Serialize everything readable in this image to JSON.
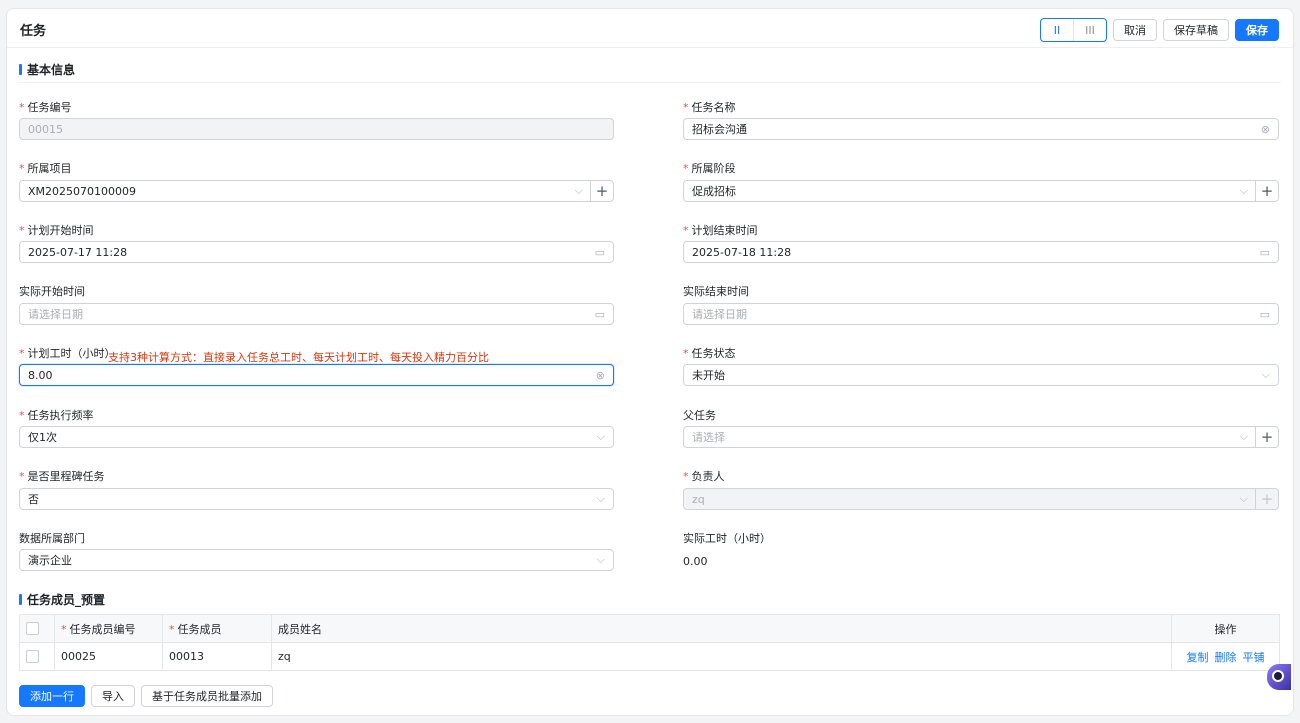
{
  "header": {
    "title": "任务",
    "view_two_col": "II",
    "view_three_col": "III",
    "cancel": "取消",
    "save_draft": "保存草稿",
    "save": "保存"
  },
  "section_basic": "基本信息",
  "required_mark": "*",
  "fields": {
    "task_no": {
      "label": "任务编号",
      "value": "00015"
    },
    "task_name": {
      "label": "任务名称",
      "value": "招标会沟通"
    },
    "project": {
      "label": "所属项目",
      "value": "XM2025070100009"
    },
    "stage": {
      "label": "所属阶段",
      "value": "促成招标"
    },
    "plan_start": {
      "label": "计划开始时间",
      "value": "2025-07-17 11:28"
    },
    "plan_end": {
      "label": "计划结束时间",
      "value": "2025-07-18 11:28"
    },
    "actual_start": {
      "label": "实际开始时间",
      "placeholder": "请选择日期"
    },
    "actual_end": {
      "label": "实际结束时间",
      "placeholder": "请选择日期"
    },
    "plan_hours": {
      "label": "计划工时（小时）",
      "value": "8.00",
      "hint": "支持3种计算方式：直接录入任务总工时、每天计划工时、每天投入精力百分比"
    },
    "status": {
      "label": "任务状态",
      "value": "未开始"
    },
    "frequency": {
      "label": "任务执行频率",
      "value": "仅1次"
    },
    "parent": {
      "label": "父任务",
      "placeholder": "请选择"
    },
    "milestone": {
      "label": "是否里程碑任务",
      "value": "否"
    },
    "owner": {
      "label": "负责人",
      "value": "zq"
    },
    "dept": {
      "label": "数据所属部门",
      "value": "演示企业"
    },
    "actual_hours": {
      "label": "实际工时（小时）",
      "value": "0.00"
    }
  },
  "members": {
    "title": "任务成员_预置",
    "columns": [
      "任务成员编号",
      "任务成员",
      "成员姓名",
      "操作"
    ],
    "rows": [
      {
        "member_no": "00025",
        "member": "00013",
        "name": "zq",
        "actions": [
          "复制",
          "删除",
          "平铺"
        ]
      }
    ],
    "buttons": {
      "add_row": "添加一行",
      "import": "导入",
      "batch_add": "基于任务成员批量添加"
    }
  },
  "colors": {
    "accent": "#1677ff",
    "required": "#e34d4d",
    "hint": "#d4380d"
  },
  "icons": [
    "calendar-icon",
    "clear-icon",
    "chevron-down-icon",
    "plus-icon",
    "assistant-icon"
  ]
}
